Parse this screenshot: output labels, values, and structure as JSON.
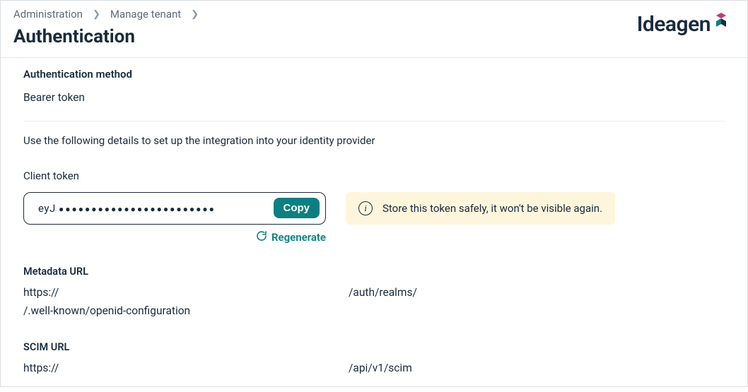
{
  "breadcrumb": {
    "item1": "Administration",
    "item2": "Manage tenant"
  },
  "brand": "Ideagen",
  "page_title": "Authentication",
  "auth_method": {
    "label": "Authentication method",
    "value": "Bearer token"
  },
  "instruction": "Use the following details to set up the integration into your identity provider",
  "client_token": {
    "label": "Client token",
    "masked_prefix": "eyJ ",
    "copy_label": "Copy",
    "regenerate_label": "Regenerate"
  },
  "alert": "Store this token safely, it won't be visible again.",
  "metadata_url": {
    "label": "Metadata URL",
    "seg1": "https://",
    "seg2": "/auth/realms/",
    "seg3": "/.well-known/openid-configuration"
  },
  "scim_url": {
    "label": "SCIM URL",
    "seg1": "https://",
    "seg2": "/api/v1/scim"
  }
}
